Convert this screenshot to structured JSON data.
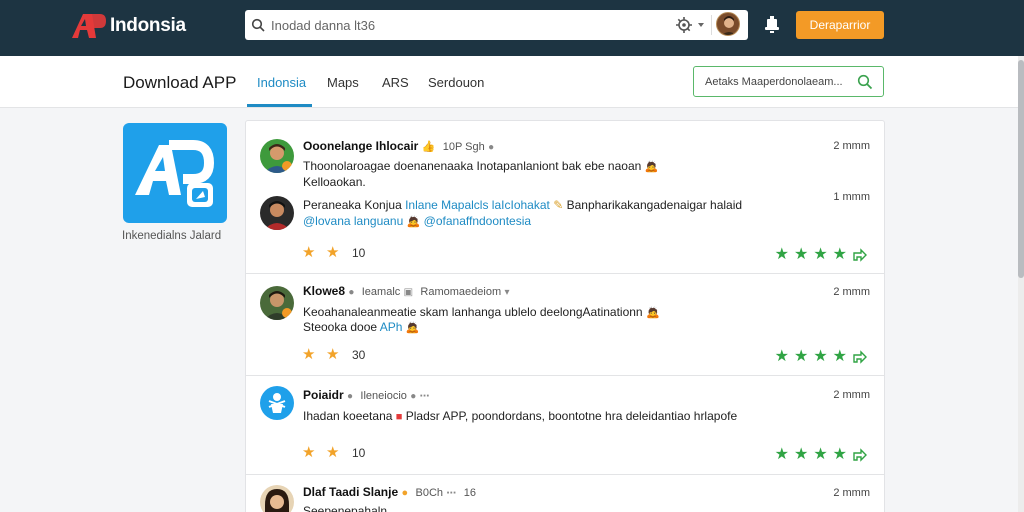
{
  "header": {
    "logo_text": "Indonsia",
    "search_placeholder": "Inodad danna lt36",
    "action_button": "Deraparrior",
    "brand_color": "#1d3442",
    "accent_color": "#f39a26"
  },
  "subheader": {
    "title": "Download APP",
    "tabs": [
      {
        "label": "Indonsia",
        "active": true
      },
      {
        "label": "Maps",
        "active": false
      },
      {
        "label": "ARS",
        "active": false
      },
      {
        "label": "Serdouon",
        "active": false
      }
    ],
    "green_field_placeholder": "Aetaks Maaperdonolaeam..."
  },
  "app": {
    "caption": "Inkenedialns Jalard"
  },
  "posts": [
    {
      "author": "Ooonelange Ihlocair",
      "meta": "10P Sgh",
      "time": "2 mmm",
      "line1": "Thoonolaroagae doenanenaaka Inotapanlaniont bak ebe naoan",
      "line2": "Kelloaokan.",
      "reply_author": "Peraneaka Konjua",
      "reply_link": "Inlane Mapalcls laIcIohakat",
      "reply_rest": "Banpharikakangadenaigar halaid",
      "reply_time": "1 mmm",
      "reply_line2_a": "@lovana languanu",
      "reply_line2_b": "@ofanaffndoontesia",
      "likes": "10",
      "rating": 4
    },
    {
      "author": "Klowe8",
      "meta": "Ieamalc",
      "meta2": "Ramomaedeiom",
      "time": "2 mmm",
      "line1": "Keoahanaleanmeatie skam lanhanga ublelo deelongAatinationn",
      "line2_a": "Steooka dooe",
      "line2_link": "APh",
      "likes": "30",
      "rating": 4
    },
    {
      "author": "Poiaidr",
      "meta": "Ileneiocio",
      "time": "2 mmm",
      "line1": "Ihadan koeetana",
      "line1_b": "Pladsr APP, poondordans, boontotne hra deleidantiao hrlapofe",
      "likes": "10",
      "rating": 4
    },
    {
      "author": "Dlaf Taadi Slanje",
      "meta": "B0Ch",
      "meta2": "16",
      "time": "2 mmm",
      "line1": "Seepenepahaln..."
    }
  ]
}
